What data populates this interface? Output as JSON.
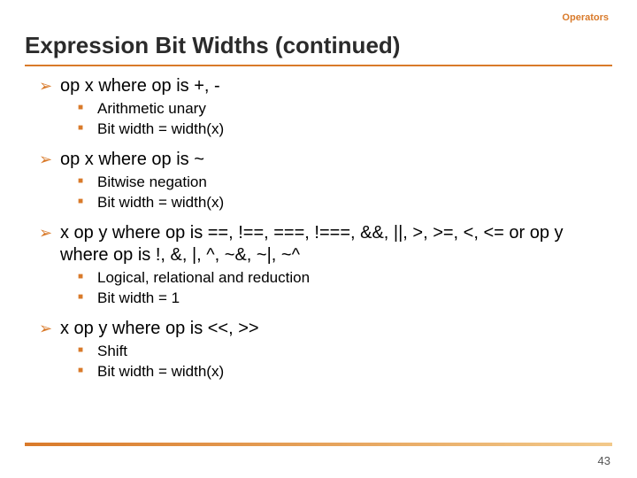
{
  "header": {
    "section_label": "Operators",
    "title": "Expression Bit Widths (continued)"
  },
  "bullets": [
    {
      "text": "op x where op is +, -",
      "sub": [
        "Arithmetic unary",
        "Bit width = width(x)"
      ]
    },
    {
      "text": "op x where op is ~",
      "sub": [
        "Bitwise negation",
        "Bit width = width(x)"
      ]
    },
    {
      "text": "x op y where op is ==, !==, ===, !===, &&, ||, >, >=, <, <= or op y where op is !, &, |, ^, ~&, ~|, ~^",
      "sub": [
        "Logical, relational and reduction",
        "Bit width = 1"
      ]
    },
    {
      "text": "x op y where op is <<, >>",
      "sub": [
        "Shift",
        "Bit width = width(x)"
      ]
    }
  ],
  "page_number": "43"
}
